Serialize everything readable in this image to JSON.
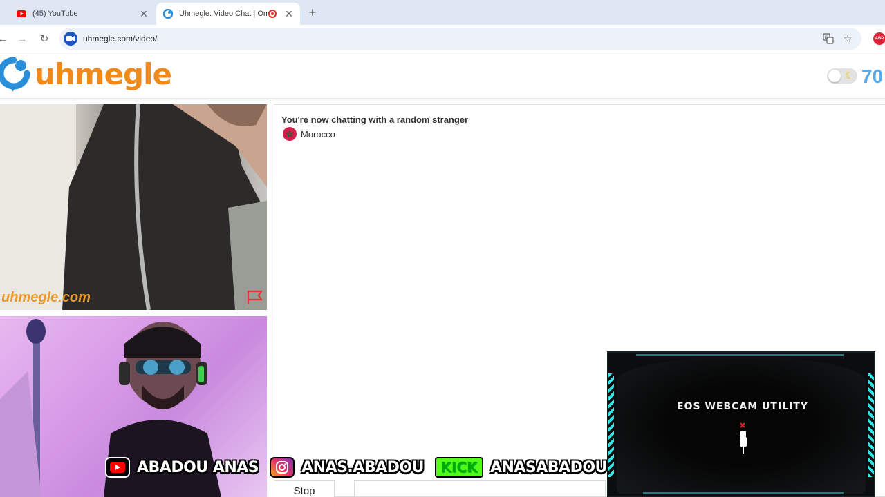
{
  "browser": {
    "tabs": [
      {
        "title": "(45) YouTube",
        "favicon": "youtube-icon",
        "active": false
      },
      {
        "title": "Uhmegle: Video Chat | Ome",
        "favicon": "uhmegle-icon",
        "active": true,
        "recording": true
      }
    ],
    "url": "uhmegle.com/video/"
  },
  "site": {
    "logo_text": "uhmegle",
    "online_count": "70",
    "brand_color": "#f08a1c",
    "accent_color": "#2a8fd8"
  },
  "chat": {
    "status": "You're now chatting with a random stranger",
    "country": "Morocco",
    "stop_label": "Stop"
  },
  "video": {
    "stranger_watermark": "uhmegle.com"
  },
  "overlay": {
    "youtube_handle": "ABADOU ANAS",
    "instagram_handle": "ANAS.ABADOU",
    "kick_label": "KICK",
    "kick_handle": "ANASABADOU",
    "eos_title": "EOS WEBCAM UTILITY"
  }
}
